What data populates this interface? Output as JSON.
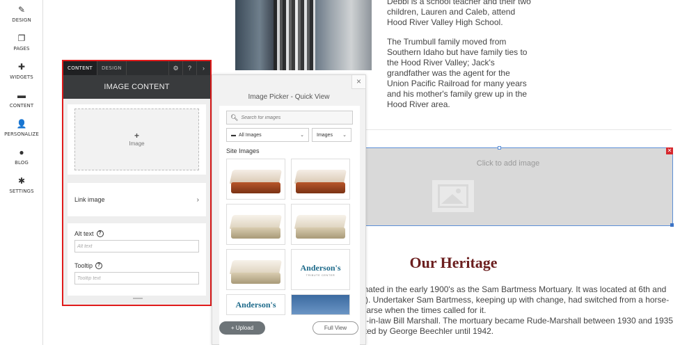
{
  "sidebar": {
    "items": [
      {
        "label": "DESIGN",
        "icon": "paintbrush-icon",
        "glyph": "✎"
      },
      {
        "label": "PAGES",
        "icon": "pages-icon",
        "glyph": "❐"
      },
      {
        "label": "WIDGETS",
        "icon": "plus-icon",
        "glyph": "✚"
      },
      {
        "label": "CONTENT",
        "icon": "folder-icon",
        "glyph": "▬"
      },
      {
        "label": "PERSONALIZE",
        "icon": "user-icon",
        "glyph": "👤"
      },
      {
        "label": "BLOG",
        "icon": "chat-bubble-icon",
        "glyph": "●"
      },
      {
        "label": "SETTINGS",
        "icon": "gear-icon",
        "glyph": "✱"
      }
    ]
  },
  "site": {
    "bio_p1": "Debbi is a school teacher and their two children, Lauren and Caleb, attend Hood River Valley High School.",
    "bio_p2": "The Trumbull family moved from Southern Idaho but have family ties to the Hood River Valley; Jack's grandfather was the agent for the Union Pacific Railroad for many years and his mother's family grew up in the Hood River area.",
    "image_placeholder": "Click to add image",
    "close_glyph": "✕",
    "heritage_title": "Our Heritage",
    "heritage_lines": [
      "ginated in the early 1900's as the Sam Bartmess Mortuary. It was located at 6th and",
      "lty). Undertaker Sam Bartmess, keeping up with change, had switched from a horse-",
      "hearse when the times called for it.",
      "on-in-law Bill Marshall. The mortuary became Rude-Marshall between 1930 and 1935",
      "rated by George Beechler until 1942."
    ]
  },
  "content_panel": {
    "tabs": [
      "CONTENT",
      "DESIGN"
    ],
    "title": "IMAGE CONTENT",
    "image_plus": "+",
    "image_label": "Image",
    "link_image": "Link image",
    "link_chevron": "›",
    "alt_text_label": "Alt text",
    "alt_text_placeholder": "Alt text",
    "tooltip_label": "Tooltip",
    "tooltip_placeholder": "Tooltip text",
    "help_glyph": "?",
    "gear_glyph": "⚙",
    "help_tab_glyph": "?",
    "collapse_glyph": "›"
  },
  "picker": {
    "title": "Image Picker - Quick View",
    "close": "×",
    "search_placeholder": "Search for images",
    "folder_select": "All Images",
    "type_select": "Images",
    "site_images_label": "Site Images",
    "logo_text": "Anderson's",
    "logo_sub": "TRIBUTE CENTER",
    "upload_label": "+ Upload",
    "full_view_label": "Full View"
  }
}
